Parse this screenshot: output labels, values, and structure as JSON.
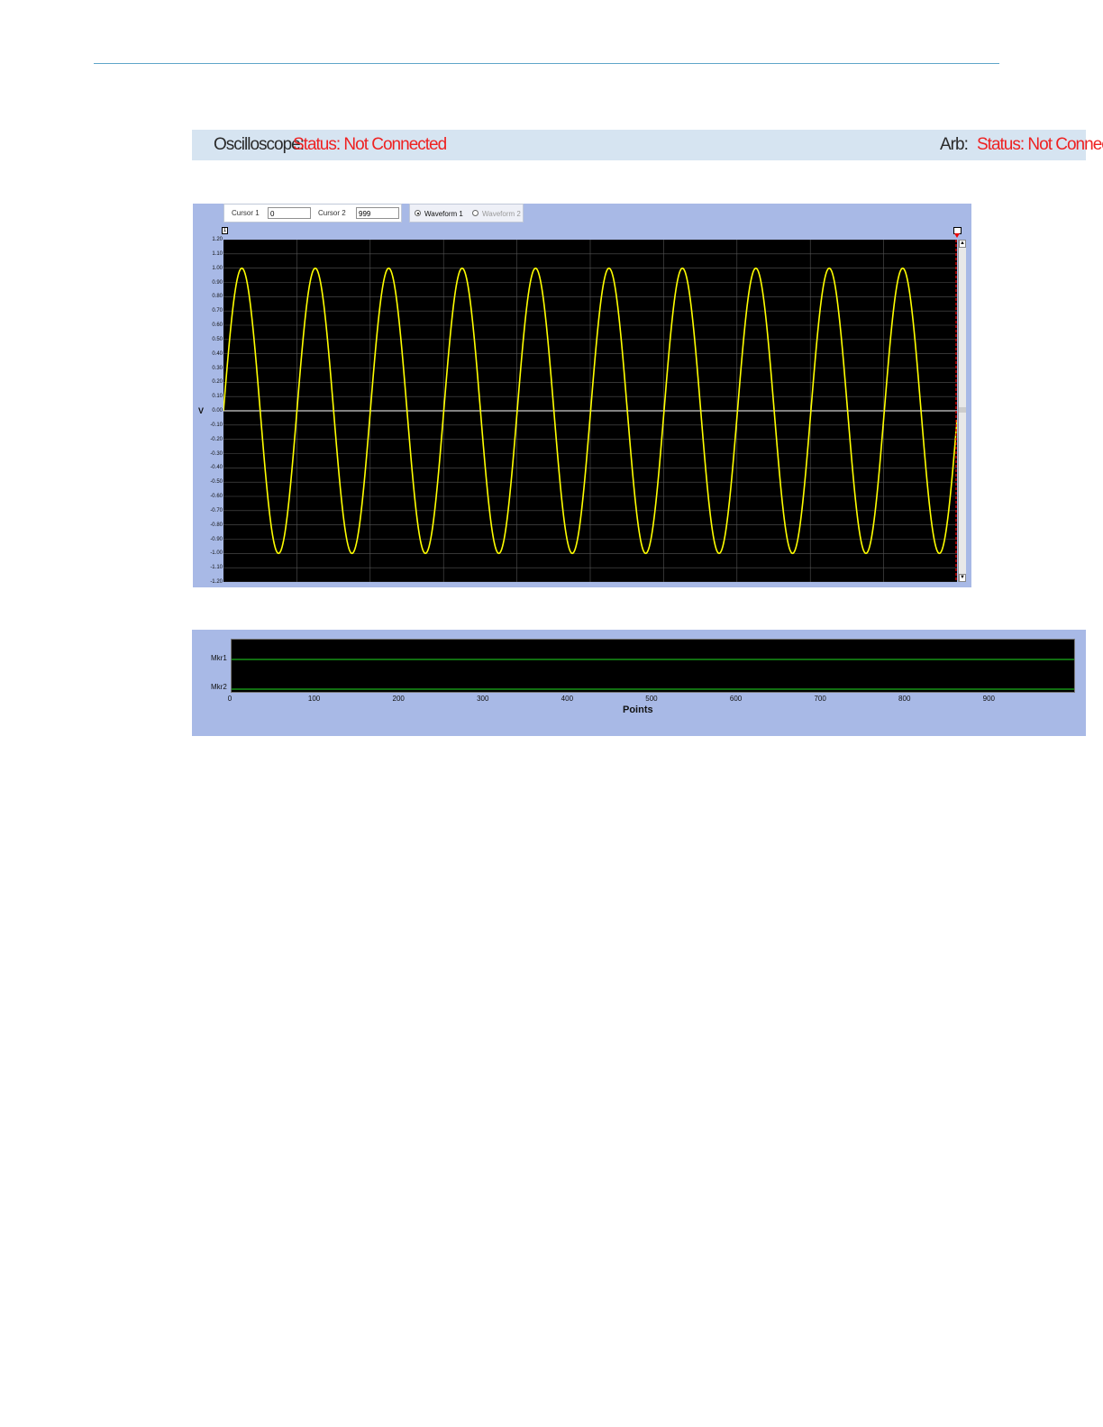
{
  "oscilloscope_label": "Oscilloscope:",
  "oscilloscope_status": "Status: Not Connected",
  "arb_label": "Arb:",
  "arb_status": "Status: Not Connected",
  "cursor1_label": "Cursor 1",
  "cursor1_value": "0",
  "cursor2_label": "Cursor 2",
  "cursor2_value": "999",
  "waveform1_label": "Waveform 1",
  "waveform2_label": "Waveform 2",
  "cursor_marker_1": "1",
  "colors": {
    "status": "#ee2222",
    "trace": "#ffff00",
    "panel": "#a8b9e6",
    "marker_line": "#22dd22",
    "cursor_line": "#ff0000"
  },
  "chart_data": [
    {
      "type": "line",
      "ylabel": "V",
      "ylim": [
        -1.2,
        1.2
      ],
      "yticks": [
        "1.20",
        "1.10",
        "1.00",
        "0.90",
        "0.80",
        "0.70",
        "0.60",
        "0.50",
        "0.40",
        "0.30",
        "0.20",
        "0.10",
        "0.00",
        "-0.10",
        "-0.20",
        "-0.30",
        "-0.40",
        "-0.50",
        "-0.60",
        "-0.70",
        "-0.80",
        "-0.90",
        "-1.00",
        "-1.10",
        "-1.20"
      ],
      "xlim": [
        0,
        999
      ],
      "series": [
        {
          "amplitude": 1.0,
          "cycles": 10,
          "points": 1000,
          "waveform": "sine"
        }
      ],
      "grid": true
    },
    {
      "type": "line",
      "xlabel": "Points",
      "xticks": [
        "0",
        "100",
        "200",
        "300",
        "400",
        "500",
        "600",
        "700",
        "800",
        "900"
      ],
      "xlim": [
        0,
        999
      ],
      "categories": [
        "Mkr1",
        "Mkr2"
      ],
      "grid": false
    }
  ]
}
